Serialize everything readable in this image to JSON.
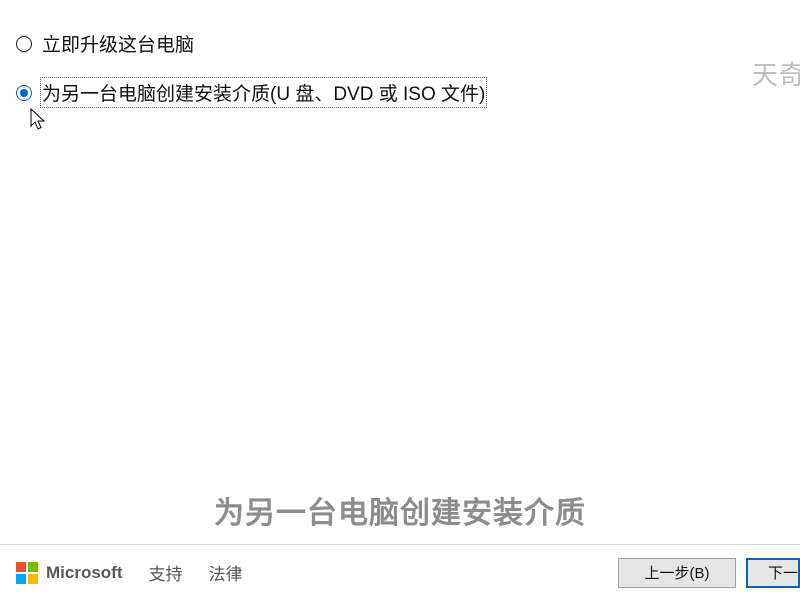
{
  "options": {
    "upgrade": "立即升级这台电脑",
    "media": "为另一台电脑创建安装介质(U 盘、DVD 或 ISO 文件)"
  },
  "watermark": "天奇",
  "caption": "为另一台电脑创建安装介质",
  "footer": {
    "brand": "Microsoft",
    "support": "支持",
    "legal": "法律",
    "back": "上一步(B)",
    "next": "下一"
  }
}
